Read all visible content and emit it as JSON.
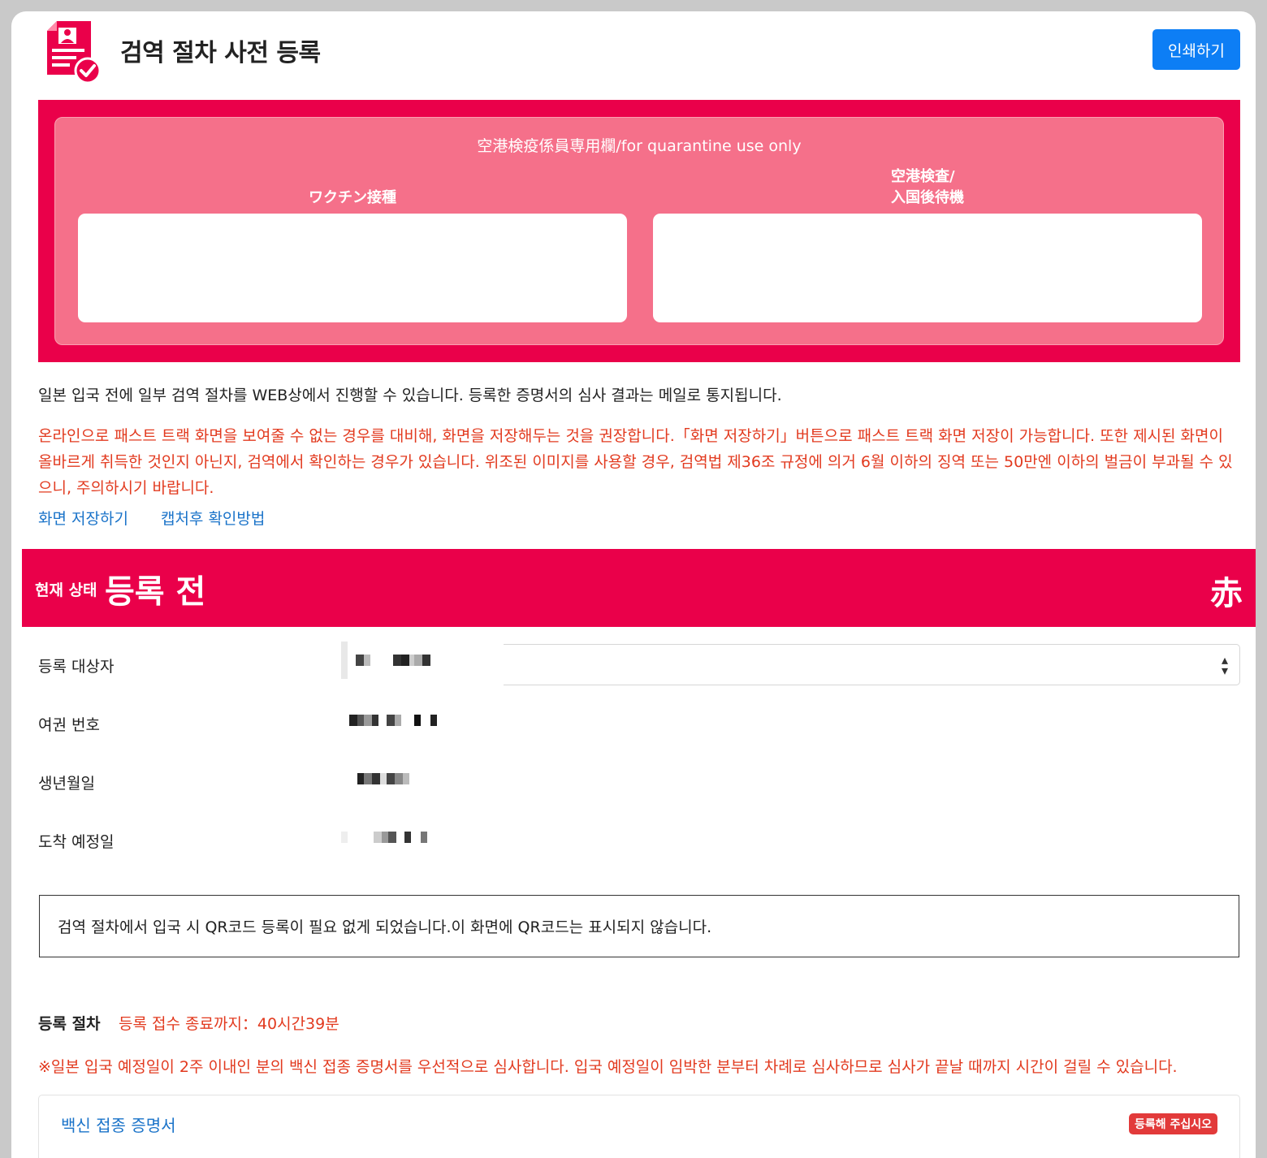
{
  "header": {
    "title": "검역 절차 사전 등록",
    "print_label": "인쇄하기"
  },
  "quarantine": {
    "title": "空港検疫係員専用欄/for quarantine use only",
    "col_left_label": "ワクチン接種",
    "col_right_label_line1": "空港検査/",
    "col_right_label_line2": "入国後待機"
  },
  "intro_text": "일본 입국 전에 일부 검역 절차를 WEB상에서 진행할 수 있습니다. 등록한 증명서의 심사 결과는 메일로 통지됩니다.",
  "warning_text": "온라인으로 패스트 트랙 화면을 보여줄 수 없는 경우를 대비해, 화면을 저장해두는 것을 권장합니다.「화면 저장하기」버튼으로 패스트 트랙 화면 저장이 가능합니다. 또한 제시된 화면이 올바르게 취득한 것인지 아닌지, 검역에서 확인하는 경우가 있습니다. 위조된 이미지를 사용할 경우, 검역법 제36조 규정에 의거 6월 이하의 징역 또는 50만엔 이하의 벌금이 부과될 수 있으니, 주의하시기 바랍니다.",
  "links": {
    "save_screen": "화면 저장하기",
    "capture_howto": "캡처후 확인방법"
  },
  "status": {
    "label": "현재 상태",
    "value": "등록 전",
    "color_kanji": "赤"
  },
  "info": {
    "registrant_label": "등록 대상자",
    "passport_label": "여권 번호",
    "birthdate_label": "생년월일",
    "arrival_label": "도착 예정일"
  },
  "notice_text": "검역 절차에서 입국 시 QR코드 등록이 필요 없게 되었습니다.이 화면에 QR코드는 표시되지 않습니다.",
  "procedure": {
    "label": "등록 절차",
    "deadline": "등록 접수 종료까지：40시간39분",
    "priority_note": "※일본 입국 예정일이 2주 이내인 분의 백신 접종 증명서를 우선적으로 심사합니다. 입국 예정일이 임박한 분부터 차례로 심사하므로 심사가 끝날 때까지 시간이 걸릴 수 있습니다."
  },
  "vaccine": {
    "title": "백신 접종 증명서",
    "badge": "등록해 주십시오"
  },
  "colors": {
    "brand_red": "#ea004a",
    "panel_pink": "#f5708a",
    "primary_blue": "#0d7ef5",
    "warning_red": "#e23a1f",
    "link_blue": "#1a73c9"
  }
}
